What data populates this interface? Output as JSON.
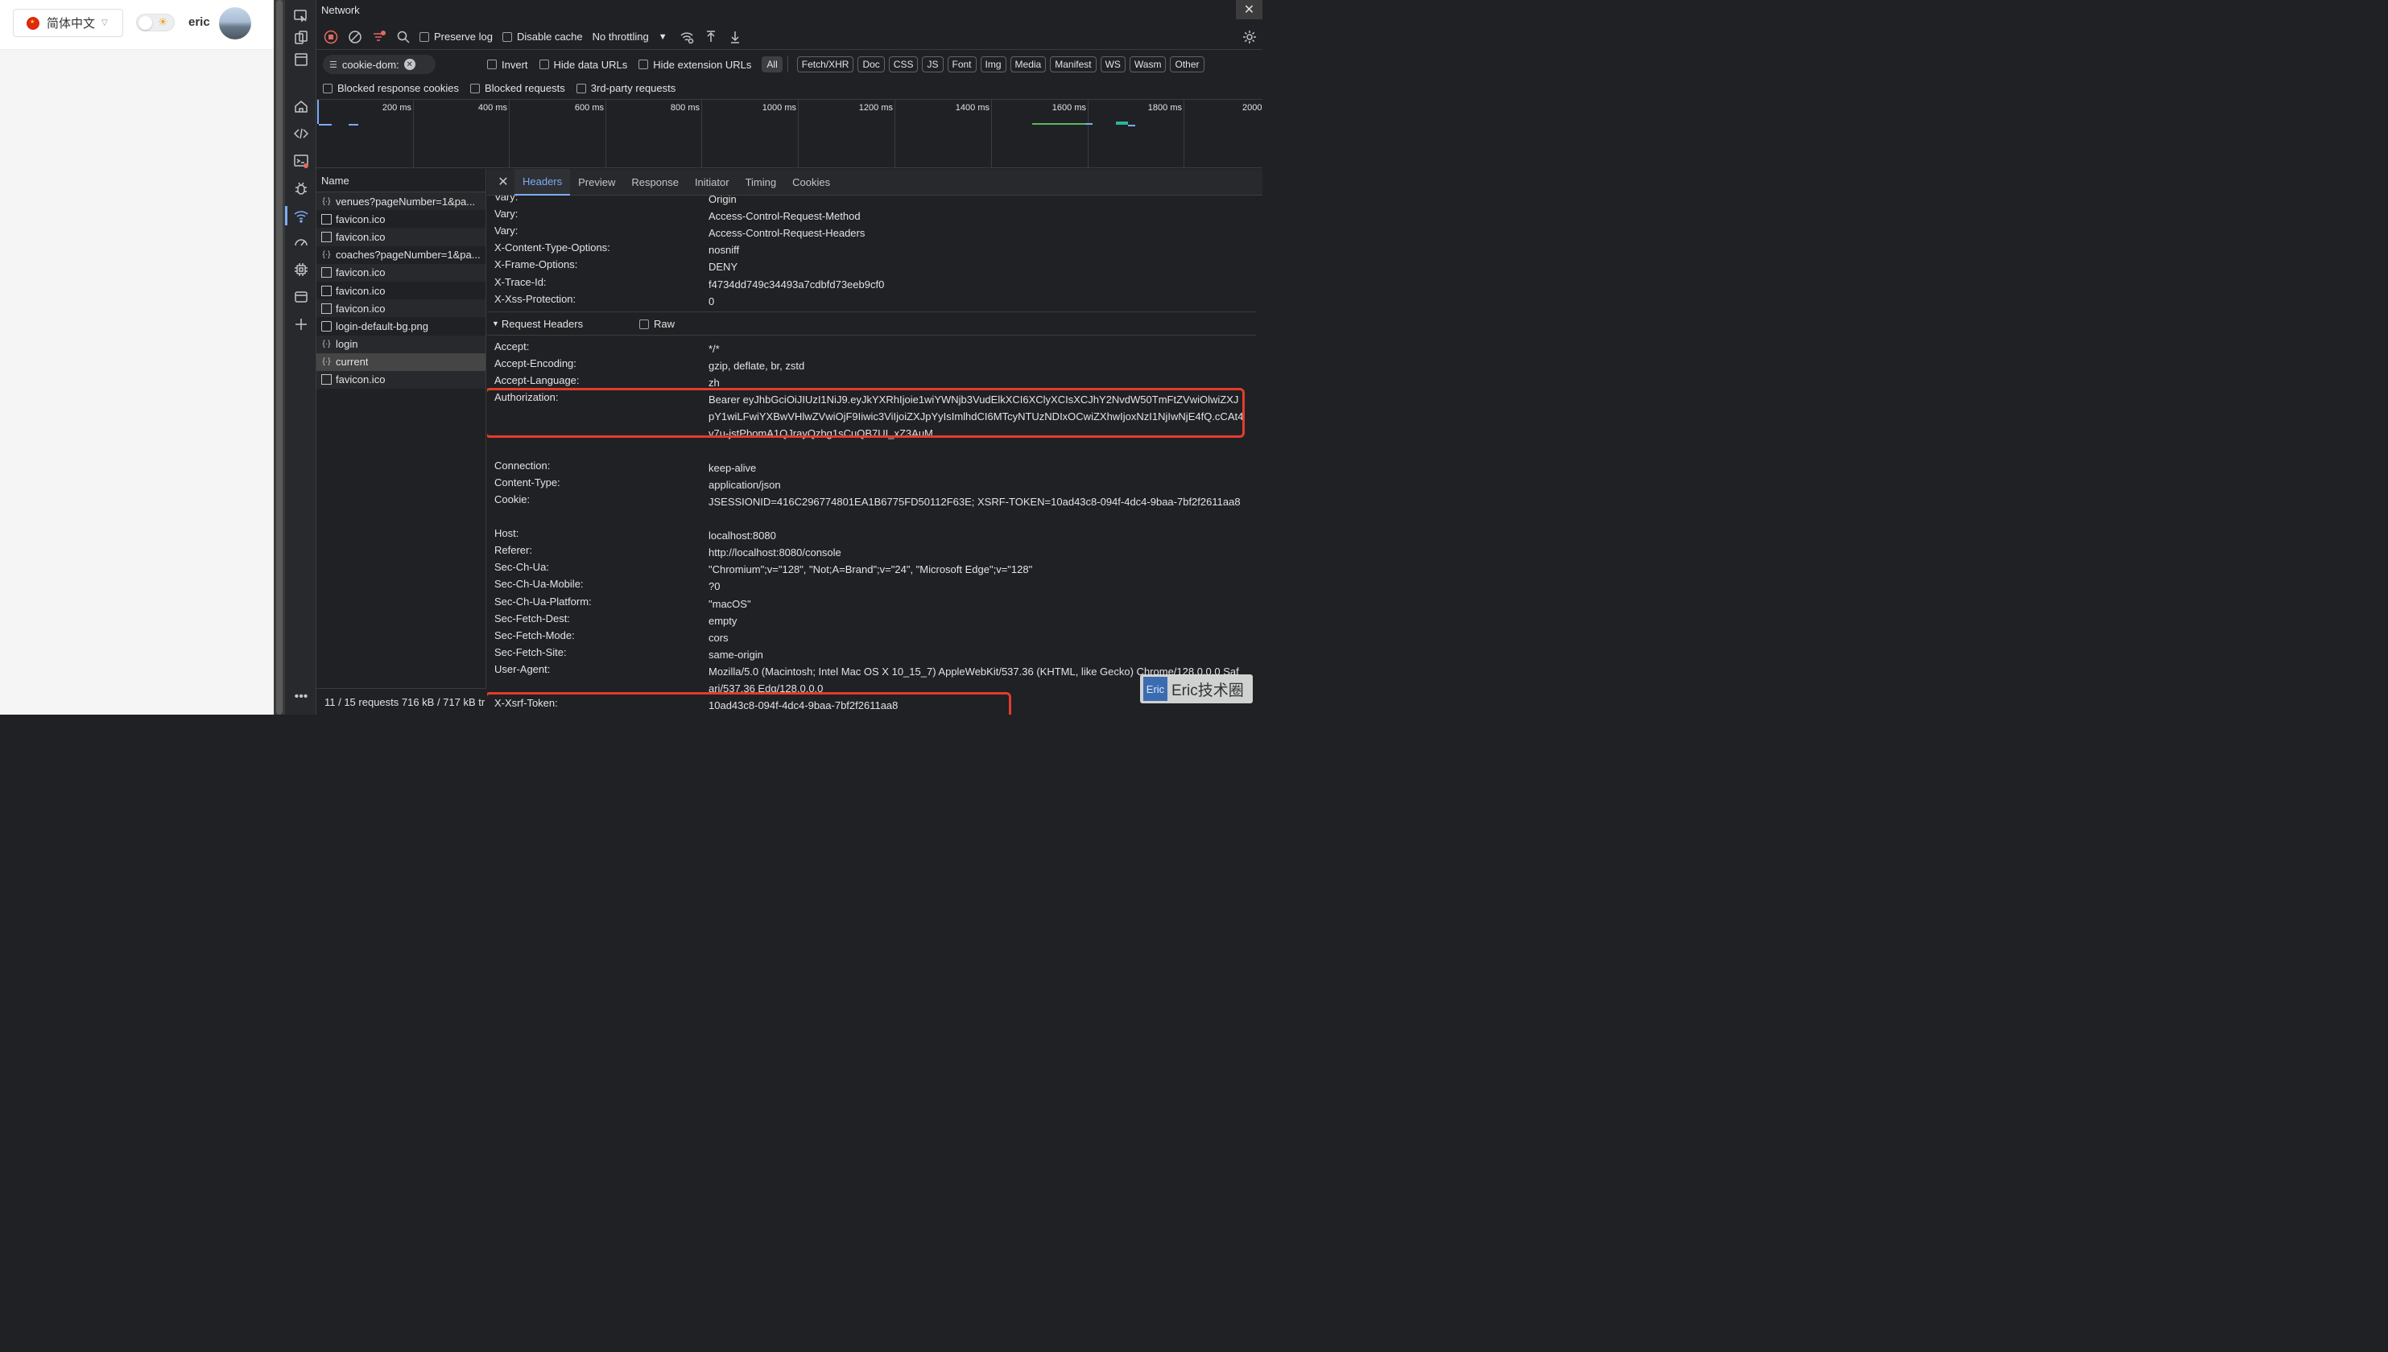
{
  "app": {
    "language": "简体中文",
    "username": "eric"
  },
  "devtools": {
    "panel_title": "Network",
    "toolbar": {
      "preserve_log": "Preserve log",
      "disable_cache": "Disable cache",
      "throttling": "No throttling"
    },
    "filter": {
      "value": "cookie-dom:"
    },
    "filter_options": [
      "Invert",
      "Hide data URLs",
      "Hide extension URLs"
    ],
    "type_filters": [
      "All",
      "Fetch/XHR",
      "Doc",
      "CSS",
      "JS",
      "Font",
      "Img",
      "Media",
      "Manifest",
      "WS",
      "Wasm",
      "Other"
    ],
    "extra_filters": [
      "Blocked response cookies",
      "Blocked requests",
      "3rd-party requests"
    ],
    "timeline_ticks": [
      "200 ms",
      "400 ms",
      "600 ms",
      "800 ms",
      "1000 ms",
      "1200 ms",
      "1400 ms",
      "1600 ms",
      "1800 ms",
      "2000"
    ],
    "request_list": {
      "header": "Name",
      "rows": [
        {
          "name": "venues?pageNumber=1&pa...",
          "type": "xhr"
        },
        {
          "name": "favicon.ico",
          "type": "img"
        },
        {
          "name": "favicon.ico",
          "type": "img"
        },
        {
          "name": "coaches?pageNumber=1&pa...",
          "type": "xhr"
        },
        {
          "name": "favicon.ico",
          "type": "img"
        },
        {
          "name": "favicon.ico",
          "type": "img"
        },
        {
          "name": "favicon.ico",
          "type": "img"
        },
        {
          "name": "login-default-bg.png",
          "type": "doc"
        },
        {
          "name": "login",
          "type": "xhr"
        },
        {
          "name": "current",
          "type": "xhr",
          "selected": true
        },
        {
          "name": "favicon.ico",
          "type": "img"
        }
      ]
    },
    "status": "11 / 15 requests  716 kB / 717 kB tr",
    "details": {
      "tabs": [
        "Headers",
        "Preview",
        "Response",
        "Initiator",
        "Timing",
        "Cookies"
      ],
      "response_headers_tail": [
        {
          "k": "Vary:",
          "v": "Origin"
        },
        {
          "k": "Vary:",
          "v": "Access-Control-Request-Method"
        },
        {
          "k": "Vary:",
          "v": "Access-Control-Request-Headers"
        },
        {
          "k": "X-Content-Type-Options:",
          "v": "nosniff"
        },
        {
          "k": "X-Frame-Options:",
          "v": "DENY"
        },
        {
          "k": "X-Trace-Id:",
          "v": "f4734dd749c34493a7cdbfd73eeb9cf0"
        },
        {
          "k": "X-Xss-Protection:",
          "v": "0"
        }
      ],
      "request_section_title": "Request Headers",
      "raw_label": "Raw",
      "request_headers": [
        {
          "k": "Accept:",
          "v": "*/*"
        },
        {
          "k": "Accept-Encoding:",
          "v": "gzip, deflate, br, zstd"
        },
        {
          "k": "Accept-Language:",
          "v": "zh"
        },
        {
          "k": "Authorization:",
          "v": "Bearer eyJhbGciOiJIUzI1NiJ9.eyJkYXRhIjoie1wiYWNjb3VudElkXCI6XClyXCIsXCJhY2NvdW50TmFtZVwiOlwiZXJpY1wiLFwiYXBwVHlwZVwiOjF9Iiwic3ViIjoiZXJpYyIsImlhdCI6MTcyNTUzNDIxOCwiZXhwIjoxNzI1NjIwNjE4fQ.cCAt4v7u-jstPbomA1QJrayQzbg1sCuQB7UI_xZ3AuM"
        },
        {
          "k": "Connection:",
          "v": "keep-alive"
        },
        {
          "k": "Content-Type:",
          "v": "application/json"
        },
        {
          "k": "Cookie:",
          "v": "JSESSIONID=416C296774801EA1B6775FD50112F63E; XSRF-TOKEN=10ad43c8-094f-4dc4-9baa-7bf2f2611aa8"
        },
        {
          "k": "Host:",
          "v": "localhost:8080"
        },
        {
          "k": "Referer:",
          "v": "http://localhost:8080/console"
        },
        {
          "k": "Sec-Ch-Ua:",
          "v": "\"Chromium\";v=\"128\", \"Not;A=Brand\";v=\"24\", \"Microsoft Edge\";v=\"128\""
        },
        {
          "k": "Sec-Ch-Ua-Mobile:",
          "v": "?0"
        },
        {
          "k": "Sec-Ch-Ua-Platform:",
          "v": "\"macOS\""
        },
        {
          "k": "Sec-Fetch-Dest:",
          "v": "empty"
        },
        {
          "k": "Sec-Fetch-Mode:",
          "v": "cors"
        },
        {
          "k": "Sec-Fetch-Site:",
          "v": "same-origin"
        },
        {
          "k": "User-Agent:",
          "v": "Mozilla/5.0 (Macintosh; Intel Mac OS X 10_15_7) AppleWebKit/537.36 (KHTML, like Gecko) Chrome/128.0.0.0 Safari/537.36 Edg/128.0.0.0"
        },
        {
          "k": "X-Xsrf-Token:",
          "v": "10ad43c8-094f-4dc4-9baa-7bf2f2611aa8"
        }
      ]
    }
  },
  "watermark": {
    "logo": "Eric",
    "text": "Eric技术圈"
  },
  "colors": {
    "accent": "#7cacf8",
    "highlight": "#e33c2b",
    "record_red": "#e46962"
  }
}
